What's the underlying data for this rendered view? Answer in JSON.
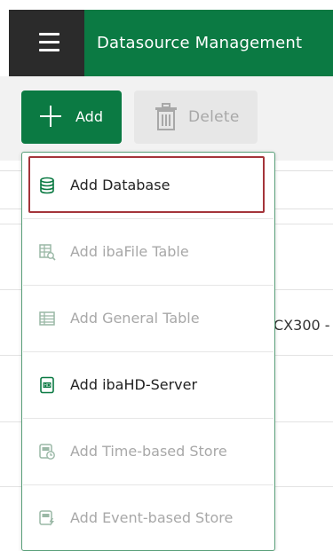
{
  "header": {
    "title": "Datasource Management"
  },
  "toolbar": {
    "add_label": "Add",
    "delete_label": "Delete"
  },
  "background": {
    "row_text": "CX300 -"
  },
  "dropdown": {
    "items": [
      {
        "label": "Add Database",
        "enabled": true,
        "highlighted": true,
        "icon": "database-icon"
      },
      {
        "label": "Add ibaFile Table",
        "enabled": false,
        "icon": "file-table-icon"
      },
      {
        "label": "Add General Table",
        "enabled": false,
        "icon": "table-icon"
      },
      {
        "label": "Add ibaHD-Server",
        "enabled": true,
        "icon": "hd-server-icon"
      },
      {
        "label": "Add Time-based Store",
        "enabled": false,
        "icon": "time-store-icon"
      },
      {
        "label": "Add Event-based Store",
        "enabled": false,
        "icon": "event-store-icon"
      }
    ]
  },
  "colors": {
    "brand_green": "#0b7a43",
    "dark_menu": "#2b2b2b",
    "highlight_red": "#a4343a",
    "disabled_text": "#a8a8a8"
  }
}
